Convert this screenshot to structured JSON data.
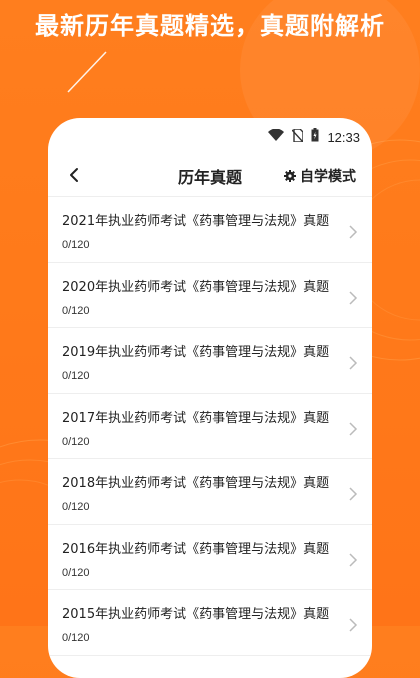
{
  "headline": "最新历年真题精选，真题附解析",
  "status_bar": {
    "time": "12:33",
    "icons": [
      "wifi-icon",
      "no-sim-icon",
      "battery-charging-icon"
    ]
  },
  "navbar": {
    "title": "历年真题",
    "back_icon": "chevron-left-icon",
    "mode_icon": "gear-icon",
    "mode_label": "自学模式"
  },
  "list": {
    "items": [
      {
        "title": "2021年执业药师考试《药事管理与法规》真题",
        "progress": "0/120"
      },
      {
        "title": "2020年执业药师考试《药事管理与法规》真题",
        "progress": "0/120"
      },
      {
        "title": "2019年执业药师考试《药事管理与法规》真题",
        "progress": "0/120"
      },
      {
        "title": "2017年执业药师考试《药事管理与法规》真题",
        "progress": "0/120"
      },
      {
        "title": "2018年执业药师考试《药事管理与法规》真题",
        "progress": "0/120"
      },
      {
        "title": "2016年执业药师考试《药事管理与法规》真题",
        "progress": "0/120"
      },
      {
        "title": "2015年执业药师考试《药事管理与法规》真题",
        "progress": "0/120"
      }
    ]
  },
  "colors": {
    "background": "#ff7a1a",
    "card": "#ffffff",
    "text": "#222222",
    "divider": "#eeeeee",
    "chevron": "#bbbbbb"
  }
}
